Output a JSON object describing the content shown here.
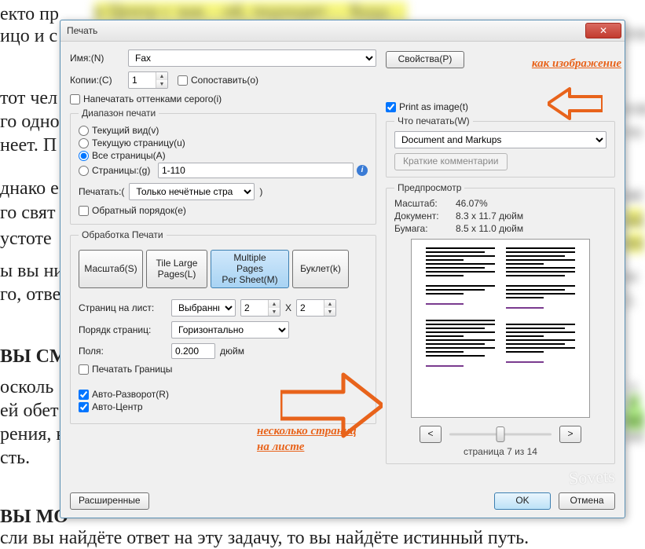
{
  "background": {
    "partials": [
      "екто пр",
      "ицо и с",
      "тот чел",
      "го одно",
      "неет. П",
      "днако е",
      "го свят",
      "устоте",
      "ы вы ни",
      "го, отве",
      " ВЫ СМ",
      "осколь",
      "ей обет",
      "рения, н",
      "сть.",
      " ВЫ МО"
    ],
    "blurs": [
      "в Центр с заж…ой, подходит… Будд…",
      "ете",
      "еле",
      "то",
      "ие",
      "дд",
      "но",
      "ы",
      ").",
      "т",
      "Г",
      "оп",
      "оп"
    ],
    "last_line": "сли вы найдёте ответ на эту задачу, то вы найдёте истинный путь."
  },
  "dialog": {
    "title": "Печать",
    "name_label": "Имя:(N)",
    "name_value": "Fax",
    "props_btn": "Свойства(P)",
    "copies_label": "Копии:(C)",
    "copies_value": "1",
    "collate": "Сопоставить(o)",
    "grayscale": "Напечатать оттенками серого(i)",
    "print_as_image": "Print as image(t)",
    "range_legend": "Диапазон печати",
    "range": {
      "current_view": "Текущий вид(v)",
      "current_page": "Текущую страницу(u)",
      "all_pages": "Все страницы(A)",
      "pages": "Страницы:(g)",
      "pages_value": "1-110",
      "print_label": "Печатать:(",
      "print_sel": "Только нечётные стра",
      "reverse": "Обратный порядок(e)"
    },
    "handling_legend": "Обработка Печати",
    "seg": {
      "scale": "Масштаб(S)",
      "tile": "Tile Large\nPages(L)",
      "multi": "Multiple Pages\nPer Sheet(M)",
      "booklet": "Буклет(k)"
    },
    "pps_label": "Страниц на лист:",
    "pps_sel": "Выбранны",
    "pps_x": "2",
    "pps_y": "2",
    "x_sep": "X",
    "order_label": "Порядк страниц:",
    "order_sel": "Горизонтально",
    "margins_label": "Поля:",
    "margins_val": "0.200",
    "margins_unit": "дюйм",
    "print_borders": "Печатать Границы",
    "auto_rotate": "Авто-Разворот(R)",
    "auto_center": "Авто-Центр",
    "advanced": "Расширенные",
    "what_legend": "Что печатать(W)",
    "what_sel": "Document and Markups",
    "summary_btn": "Краткие комментарии",
    "preview_legend": "Предпросмотр",
    "kv": {
      "scale_l": "Масштаб:",
      "scale_v": "46.07%",
      "doc_l": "Документ:",
      "doc_v": "8.3 x 11.7 дюйм",
      "paper_l": "Бумага:",
      "paper_v": "8.5 x 11.0 дюйм"
    },
    "nav_prev": "<",
    "nav_next": ">",
    "page_indicator": "страница 7 из 14",
    "ok": "OK",
    "cancel": "Отмена"
  },
  "annotations": {
    "as_image": "как изображение",
    "multi1": "несколько страниц",
    "multi2": "на листе"
  }
}
